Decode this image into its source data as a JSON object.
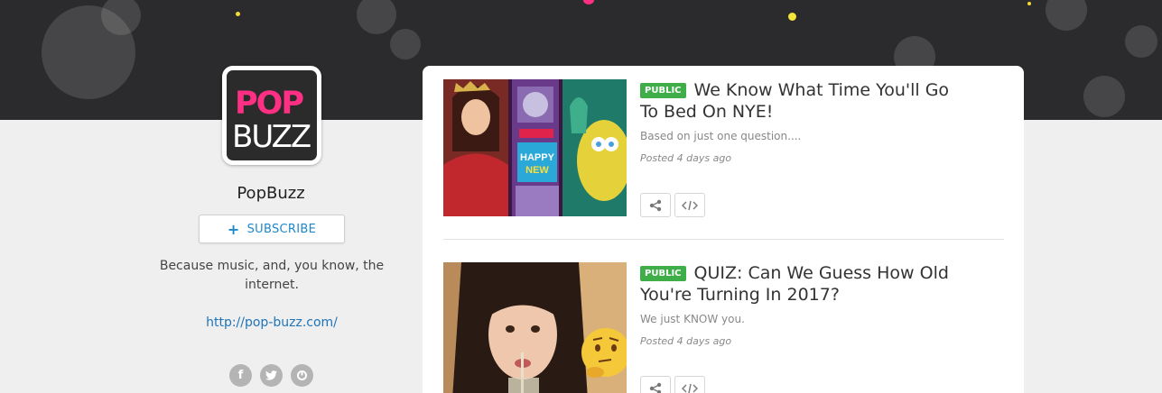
{
  "channel": {
    "logo_top": "POP",
    "logo_bottom": "BUZZ",
    "name": "PopBuzz",
    "subscribe_label": "SUBSCRIBE",
    "bio": "Because music, and, you know, the internet.",
    "website": "http://pop-buzz.com/",
    "social_icons": [
      "facebook-icon",
      "twitter-icon",
      "vine-icon"
    ]
  },
  "quizzes": [
    {
      "badge": "PUBLIC",
      "title": "We Know What Time You'll Go To Bed On NYE!",
      "description": "Based on just one question....",
      "posted": "Posted 4 days ago"
    },
    {
      "badge": "PUBLIC",
      "title": "QUIZ: Can We Guess How Old You're Turning In 2017?",
      "description": "We just KNOW you.",
      "posted": "Posted 4 days ago"
    }
  ],
  "colors": {
    "banner": "#2b2a2c",
    "accent_pink": "#ff2f84",
    "link_blue": "#1f74b8",
    "badge_green": "#3fae49"
  }
}
